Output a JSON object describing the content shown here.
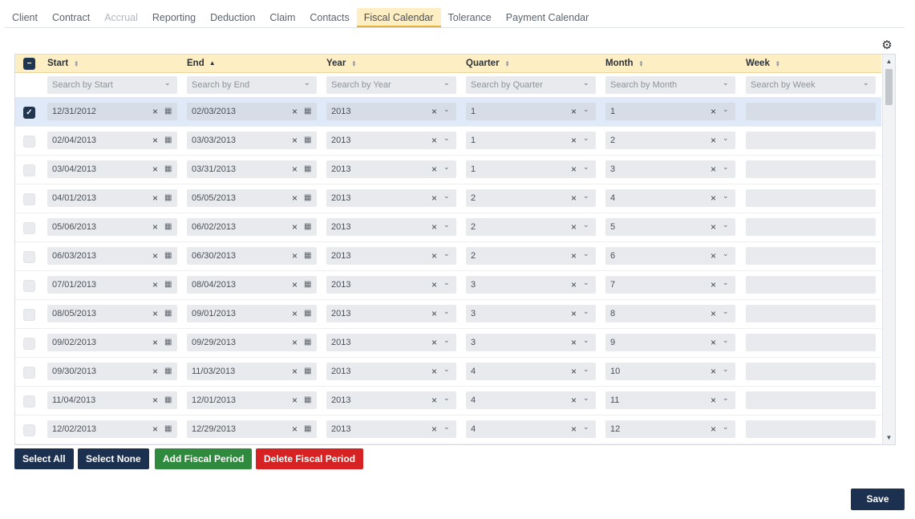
{
  "tabs": [
    {
      "label": "Client",
      "state": "normal"
    },
    {
      "label": "Contract",
      "state": "normal"
    },
    {
      "label": "Accrual",
      "state": "disabled"
    },
    {
      "label": "Reporting",
      "state": "normal"
    },
    {
      "label": "Deduction",
      "state": "normal"
    },
    {
      "label": "Claim",
      "state": "normal"
    },
    {
      "label": "Contacts",
      "state": "normal"
    },
    {
      "label": "Fiscal Calendar",
      "state": "active"
    },
    {
      "label": "Tolerance",
      "state": "normal"
    },
    {
      "label": "Payment Calendar",
      "state": "normal"
    }
  ],
  "toolbar": {
    "settings_icon": "gear-icon"
  },
  "grid": {
    "columns": [
      {
        "key": "start",
        "label": "Start",
        "sort": "none",
        "filter_placeholder": "Search by Start"
      },
      {
        "key": "end",
        "label": "End",
        "sort": "asc",
        "filter_placeholder": "Search by End"
      },
      {
        "key": "year",
        "label": "Year",
        "sort": "none",
        "filter_placeholder": "Search by Year"
      },
      {
        "key": "quarter",
        "label": "Quarter",
        "sort": "none",
        "filter_placeholder": "Search by Quarter"
      },
      {
        "key": "month",
        "label": "Month",
        "sort": "none",
        "filter_placeholder": "Search by Month"
      },
      {
        "key": "week",
        "label": "Week",
        "sort": "none",
        "filter_placeholder": "Search by Week"
      }
    ],
    "header_checkbox_state": "partial",
    "rows": [
      {
        "selected": true,
        "start": "12/31/2012",
        "end": "02/03/2013",
        "year": "2013",
        "quarter": "1",
        "month": "1",
        "week": ""
      },
      {
        "selected": false,
        "start": "02/04/2013",
        "end": "03/03/2013",
        "year": "2013",
        "quarter": "1",
        "month": "2",
        "week": ""
      },
      {
        "selected": false,
        "start": "03/04/2013",
        "end": "03/31/2013",
        "year": "2013",
        "quarter": "1",
        "month": "3",
        "week": ""
      },
      {
        "selected": false,
        "start": "04/01/2013",
        "end": "05/05/2013",
        "year": "2013",
        "quarter": "2",
        "month": "4",
        "week": ""
      },
      {
        "selected": false,
        "start": "05/06/2013",
        "end": "06/02/2013",
        "year": "2013",
        "quarter": "2",
        "month": "5",
        "week": ""
      },
      {
        "selected": false,
        "start": "06/03/2013",
        "end": "06/30/2013",
        "year": "2013",
        "quarter": "2",
        "month": "6",
        "week": ""
      },
      {
        "selected": false,
        "start": "07/01/2013",
        "end": "08/04/2013",
        "year": "2013",
        "quarter": "3",
        "month": "7",
        "week": ""
      },
      {
        "selected": false,
        "start": "08/05/2013",
        "end": "09/01/2013",
        "year": "2013",
        "quarter": "3",
        "month": "8",
        "week": ""
      },
      {
        "selected": false,
        "start": "09/02/2013",
        "end": "09/29/2013",
        "year": "2013",
        "quarter": "3",
        "month": "9",
        "week": ""
      },
      {
        "selected": false,
        "start": "09/30/2013",
        "end": "11/03/2013",
        "year": "2013",
        "quarter": "4",
        "month": "10",
        "week": ""
      },
      {
        "selected": false,
        "start": "11/04/2013",
        "end": "12/01/2013",
        "year": "2013",
        "quarter": "4",
        "month": "11",
        "week": ""
      },
      {
        "selected": false,
        "start": "12/02/2013",
        "end": "12/29/2013",
        "year": "2013",
        "quarter": "4",
        "month": "12",
        "week": ""
      }
    ]
  },
  "actions": {
    "select_all": "Select All",
    "select_none": "Select None",
    "add_period": "Add Fiscal Period",
    "delete_period": "Delete Fiscal Period"
  },
  "save_label": "Save",
  "colors": {
    "accent_header": "#fdeec4",
    "navy": "#1c3150",
    "green": "#2f8a3e",
    "red": "#d62222"
  }
}
